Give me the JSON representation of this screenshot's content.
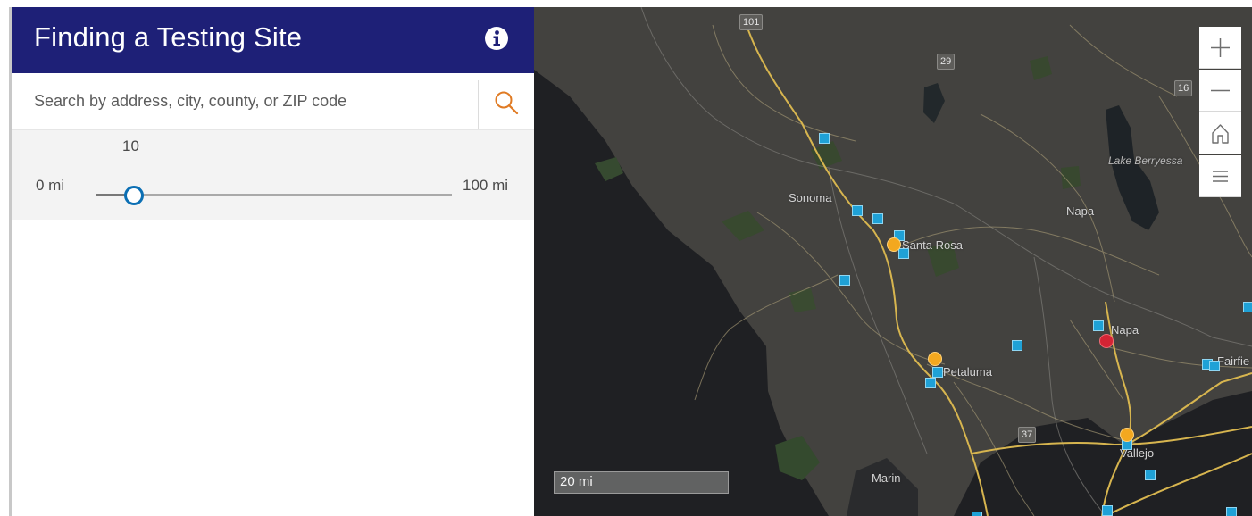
{
  "header": {
    "title": "Finding a Testing Site",
    "info_icon": "info-circle-icon",
    "color": "#1e2077"
  },
  "search": {
    "placeholder": "Search by address, city, county, or ZIP code",
    "value": "",
    "icon": "search-icon",
    "icon_color": "#e07b24"
  },
  "distance_slider": {
    "value": "10",
    "min_label": "0 mi",
    "max_label": "100 mi",
    "min": 0,
    "max": 100,
    "current": 10,
    "accent": "#0b6fb4"
  },
  "map": {
    "controls": [
      {
        "name": "zoom-in-button",
        "icon": "plus-icon"
      },
      {
        "name": "zoom-out-button",
        "icon": "minus-icon"
      },
      {
        "name": "home-button",
        "icon": "home-icon"
      },
      {
        "name": "layer-list-button",
        "icon": "list-icon"
      }
    ],
    "scalebar": "20 mi",
    "labels": {
      "sonoma": "Sonoma",
      "santa_rosa": "Santa Rosa",
      "napa_region": "Napa",
      "napa_city": "Napa",
      "petaluma": "Petaluma",
      "vallejo": "Vallejo",
      "fairfield": "Fairfie",
      "marin": "Marin",
      "lake_berryessa": "Lake Berryessa"
    },
    "highway_shields": {
      "hwy_101": "101",
      "hwy_29": "29",
      "hwy_16": "16",
      "hwy_37": "37"
    },
    "legend_colors": {
      "square_site": "#1fa1d6",
      "circle_site": "#f3a81f",
      "highlight_site": "#d32434"
    }
  }
}
